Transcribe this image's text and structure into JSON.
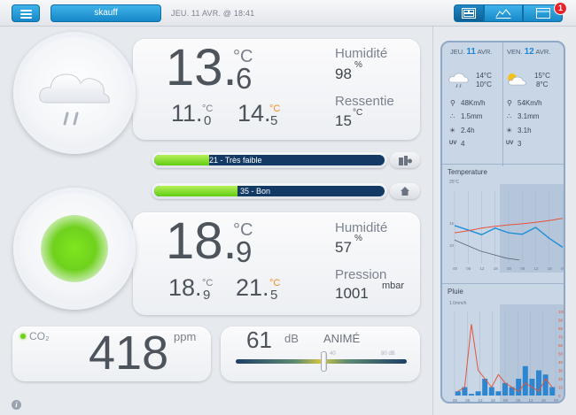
{
  "header": {
    "station": "skauff",
    "datetime": "JEU. 11 AVR. @ 18:41",
    "notification_count": "1"
  },
  "outdoor": {
    "temp_int": "13.",
    "temp_dec": "6",
    "temp_unit": "°C",
    "min_int": "11.",
    "min_dec": "0",
    "min_unit": "°C",
    "max_int": "14.",
    "max_dec": "5",
    "max_unit": "°C",
    "humidity_label": "Humidité",
    "humidity_value": "98",
    "humidity_unit": "%",
    "feels_label": "Ressentie",
    "feels_value": "15",
    "feels_unit": "°C",
    "air_quality": "21 - Très faible",
    "air_quality_level": 0.24
  },
  "indoor": {
    "air_quality": "35 - Bon",
    "air_quality_level": 0.36,
    "temp_int": "18.",
    "temp_dec": "9",
    "temp_unit": "°C",
    "min_int": "18.",
    "min_dec": "9",
    "min_unit": "°C",
    "max_int": "21.",
    "max_dec": "5",
    "max_unit": "°C",
    "humidity_label": "Humidité",
    "humidity_value": "57",
    "humidity_unit": "%",
    "pressure_label": "Pression",
    "pressure_value": "1001",
    "pressure_unit": "mbar",
    "status_color": "#6fe01a"
  },
  "co2": {
    "label": "CO₂",
    "value": "418",
    "unit": "ppm"
  },
  "noise": {
    "value": "61",
    "unit": "dB",
    "status": "ANIMÉ",
    "scale_low": "40",
    "scale_high": "80 dB",
    "level": 0.52
  },
  "forecast": {
    "days": [
      {
        "name": "JEU.",
        "num": "11",
        "month": "AVR.",
        "max": "14°C",
        "min": "10°C",
        "wind": "48Km/h",
        "rain": "1.5mm",
        "sun": "2.4h",
        "uv": "4"
      },
      {
        "name": "VEN.",
        "num": "12",
        "month": "AVR.",
        "max": "15°C",
        "min": "8°C",
        "wind": "54Km/h",
        "rain": "3.1mm",
        "sun": "3.1h",
        "uv": "3"
      }
    ],
    "uv_label": "UV"
  },
  "temp_chart": {
    "title": "Temperature",
    "unit": "25°C",
    "y_ticks": [
      "15",
      "10"
    ],
    "x_ticks": [
      "00",
      "06",
      "12",
      "18",
      "00",
      "06",
      "12",
      "18",
      "00"
    ]
  },
  "rain_chart": {
    "title": "Pluie",
    "unit": "1.0mm/h",
    "right_ticks": [
      "100%",
      "90",
      "80",
      "70",
      "60",
      "50",
      "40",
      "30",
      "20",
      "10",
      "0"
    ],
    "x_ticks": [
      "00",
      "06",
      "12",
      "18",
      "00",
      "06",
      "12",
      "18",
      "00"
    ]
  },
  "colors": {
    "accent": "#1c97d9",
    "green": "#6fd11d",
    "bar_track": "#123a64",
    "orange": "#f28b1e"
  },
  "chart_data": [
    {
      "type": "line",
      "title": "Temperature",
      "ylabel": "°C",
      "x": [
        "00",
        "06",
        "12",
        "18",
        "00",
        "06",
        "12",
        "18",
        "00"
      ],
      "ylim": [
        5,
        25
      ],
      "series": [
        {
          "values": [
            15.5,
            14.3,
            13.0,
            14.8,
            13.5,
            13.1,
            15.0,
            12.0,
            9.5
          ]
        },
        {
          "values": [
            13.5,
            14.1,
            14.8,
            15.3,
            15.7,
            16.0,
            16.4,
            16.9,
            17.5
          ]
        },
        {
          "values": [
            11.5,
            10.0,
            8.5,
            7.5,
            6.5,
            6.0
          ]
        }
      ]
    },
    {
      "type": "bar",
      "title": "Pluie",
      "ylabel": "mm/h",
      "x": [
        "00",
        "06",
        "12",
        "18",
        "00",
        "06",
        "12",
        "18",
        "00"
      ],
      "series": [
        {
          "name": "rain",
          "values": [
            0.05,
            0.1,
            0.02,
            0.05,
            0.2,
            0.1,
            0.05,
            0.15,
            0.1,
            0.2,
            0.35,
            0.2,
            0.3,
            0.25,
            0.1
          ]
        },
        {
          "name": "%",
          "values": [
            5,
            10,
            85,
            30,
            20,
            10,
            25,
            15,
            10,
            5,
            15,
            10,
            5,
            20,
            10
          ]
        }
      ]
    }
  ]
}
